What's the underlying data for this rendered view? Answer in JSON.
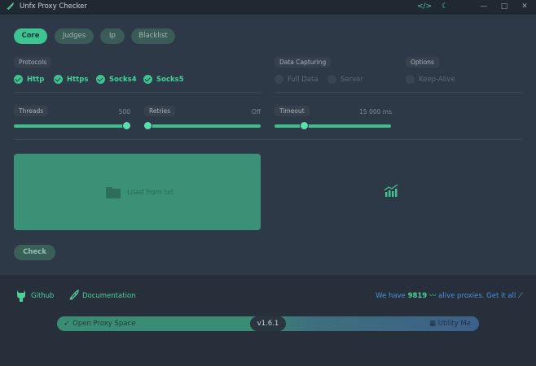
{
  "window": {
    "title": "Unfx Proxy Checker",
    "controls": {
      "code": "</>",
      "theme": "☾",
      "minimize": "—",
      "maximize": "□",
      "close": "✕"
    }
  },
  "tabs": [
    {
      "label": "Core",
      "active": true
    },
    {
      "label": "Judges",
      "active": false
    },
    {
      "label": "Ip",
      "active": false
    },
    {
      "label": "Blacklist",
      "active": false
    }
  ],
  "protocols": {
    "label": "Protocols",
    "items": [
      {
        "label": "Http",
        "checked": true
      },
      {
        "label": "Https",
        "checked": true
      },
      {
        "label": "Socks4",
        "checked": true
      },
      {
        "label": "Socks5",
        "checked": true
      }
    ]
  },
  "data_capturing": {
    "label": "Data Capturing",
    "items": [
      {
        "label": "Full Data",
        "checked": false
      },
      {
        "label": "Server",
        "checked": false
      }
    ]
  },
  "options": {
    "label": "Options",
    "items": [
      {
        "label": "Keep-Alive",
        "checked": false
      }
    ]
  },
  "sliders": {
    "threads": {
      "label": "Threads",
      "value": "500",
      "fraction": 1.0
    },
    "retries": {
      "label": "Retries",
      "value": "Off",
      "fraction": 0.0
    },
    "timeout": {
      "label": "Timeout",
      "value": "15 000 ms",
      "fraction": 0.25
    }
  },
  "load": {
    "label": "Load from txt"
  },
  "check_button": {
    "label": "Check"
  },
  "footer": {
    "github": "Github",
    "documentation": "Documentation",
    "alive": {
      "prefix": "We have",
      "count": "9819",
      "suffix": "alive proxies.",
      "cta": "Get it all"
    }
  },
  "bottom_bar": {
    "left": "Open Proxy Space",
    "version": "v1.6.1",
    "right": "Utility Me"
  },
  "colors": {
    "accent": "#3ec392",
    "panel": "#2e3947",
    "background": "#262f3a",
    "link_blue": "#4f8fd9"
  }
}
